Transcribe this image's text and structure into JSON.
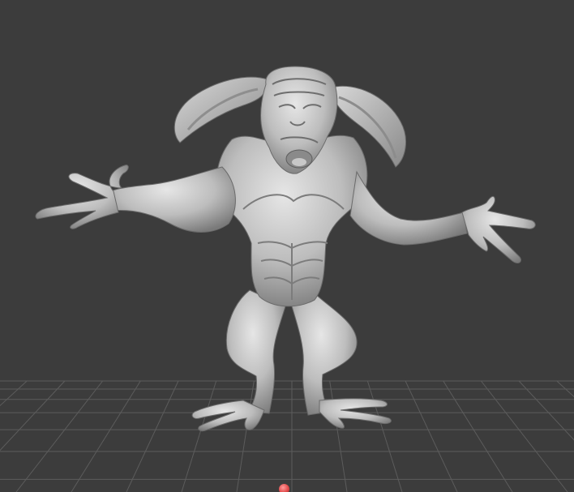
{
  "viewport": {
    "background_color": "#3c3c3c",
    "grid_color": "#5c5c5c",
    "grid_visible": true
  },
  "model": {
    "name": "sculpt-mesh",
    "surface_color": "#bdbdbd",
    "shadow_color": "#6e6e6e",
    "highlight_color": "#e2e2e2"
  },
  "origin_marker": {
    "color": "#e04a4a",
    "icon": "origin-dot-icon"
  }
}
